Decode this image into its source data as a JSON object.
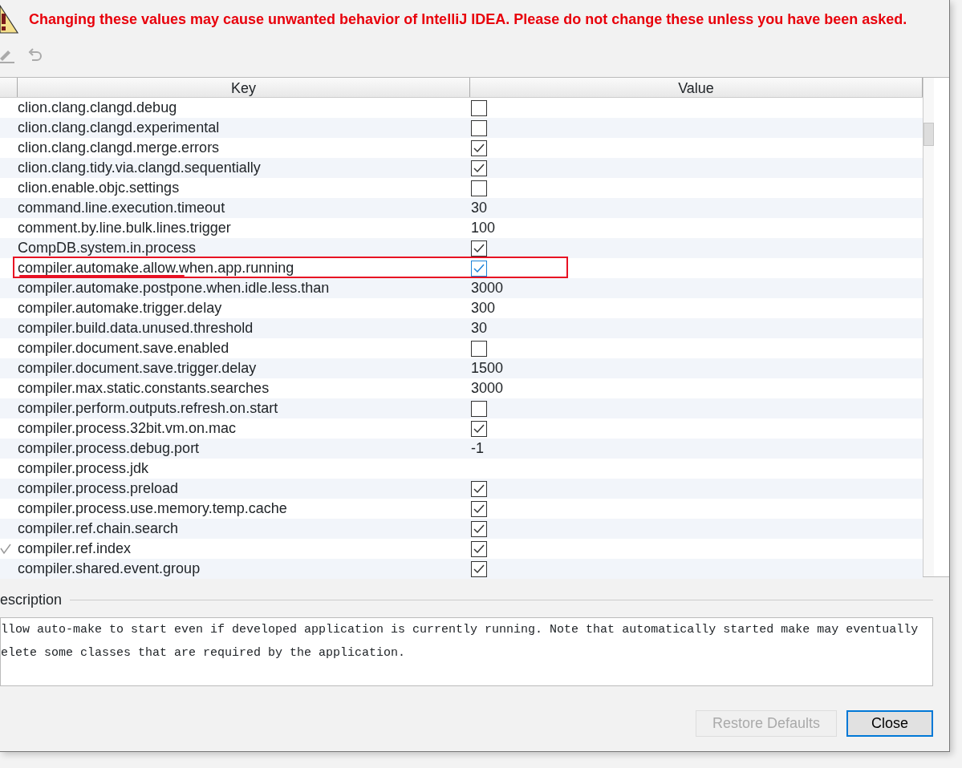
{
  "warning": {
    "text": "Changing these values may cause unwanted behavior of IntelliJ IDEA. Please do not change these unless you have been asked."
  },
  "toolbar": [
    {
      "kind": "edit",
      "disabled": true
    },
    {
      "kind": "undo",
      "disabled": true
    }
  ],
  "table": {
    "columns": [
      "Key",
      "Value"
    ],
    "rows": [
      {
        "key": "clion.clang.clangd.debug",
        "kind": "checkbox",
        "checked": false,
        "modified": false,
        "annotated": false
      },
      {
        "key": "clion.clang.clangd.experimental",
        "kind": "checkbox",
        "checked": false,
        "modified": false,
        "annotated": false
      },
      {
        "key": "clion.clang.clangd.merge.errors",
        "kind": "checkbox",
        "checked": true,
        "modified": false,
        "annotated": false
      },
      {
        "key": "clion.clang.tidy.via.clangd.sequentially",
        "kind": "checkbox",
        "checked": true,
        "modified": false,
        "annotated": false
      },
      {
        "key": "clion.enable.objc.settings",
        "kind": "checkbox",
        "checked": false,
        "modified": false,
        "annotated": false
      },
      {
        "key": "command.line.execution.timeout",
        "kind": "text",
        "value": "30",
        "modified": false,
        "annotated": false
      },
      {
        "key": "comment.by.line.bulk.lines.trigger",
        "kind": "text",
        "value": "100",
        "modified": false,
        "annotated": false
      },
      {
        "key": "CompDB.system.in.process",
        "kind": "checkbox",
        "checked": true,
        "modified": false,
        "annotated": false
      },
      {
        "key": "compiler.automake.allow.when.app.running",
        "kind": "checkbox",
        "checked": true,
        "modified": false,
        "annotated": true
      },
      {
        "key": "compiler.automake.postpone.when.idle.less.than",
        "kind": "text",
        "value": "3000",
        "modified": false,
        "annotated": false
      },
      {
        "key": "compiler.automake.trigger.delay",
        "kind": "text",
        "value": "300",
        "modified": false,
        "annotated": false
      },
      {
        "key": "compiler.build.data.unused.threshold",
        "kind": "text",
        "value": "30",
        "modified": false,
        "annotated": false
      },
      {
        "key": "compiler.document.save.enabled",
        "kind": "checkbox",
        "checked": false,
        "modified": false,
        "annotated": false
      },
      {
        "key": "compiler.document.save.trigger.delay",
        "kind": "text",
        "value": "1500",
        "modified": false,
        "annotated": false
      },
      {
        "key": "compiler.max.static.constants.searches",
        "kind": "text",
        "value": "3000",
        "modified": false,
        "annotated": false
      },
      {
        "key": "compiler.perform.outputs.refresh.on.start",
        "kind": "checkbox",
        "checked": false,
        "modified": false,
        "annotated": false
      },
      {
        "key": "compiler.process.32bit.vm.on.mac",
        "kind": "checkbox",
        "checked": true,
        "modified": false,
        "annotated": false
      },
      {
        "key": "compiler.process.debug.port",
        "kind": "text",
        "value": "-1",
        "modified": false,
        "annotated": false
      },
      {
        "key": "compiler.process.jdk",
        "kind": "text",
        "modified": false,
        "annotated": false
      },
      {
        "key": "compiler.process.preload",
        "kind": "checkbox",
        "checked": true,
        "modified": false,
        "annotated": false
      },
      {
        "key": "compiler.process.use.memory.temp.cache",
        "kind": "checkbox",
        "checked": true,
        "modified": false,
        "annotated": false
      },
      {
        "key": "compiler.ref.chain.search",
        "kind": "checkbox",
        "checked": true,
        "modified": false,
        "annotated": false
      },
      {
        "key": "compiler.ref.index",
        "kind": "checkbox",
        "checked": true,
        "modified": true,
        "annotated": false
      },
      {
        "key": "compiler.shared.event.group",
        "kind": "checkbox",
        "checked": true,
        "modified": false,
        "annotated": false
      }
    ]
  },
  "description": {
    "label": "escription",
    "lines": [
      "llow auto-make to start even if developed application is currently running. Note that automatically started make may eventually",
      "elete some classes that are required by the application."
    ]
  },
  "buttons": [
    {
      "label": "Restore Defaults",
      "disabled": true,
      "default": false
    },
    {
      "label": "Close",
      "disabled": false,
      "default": true
    }
  ]
}
